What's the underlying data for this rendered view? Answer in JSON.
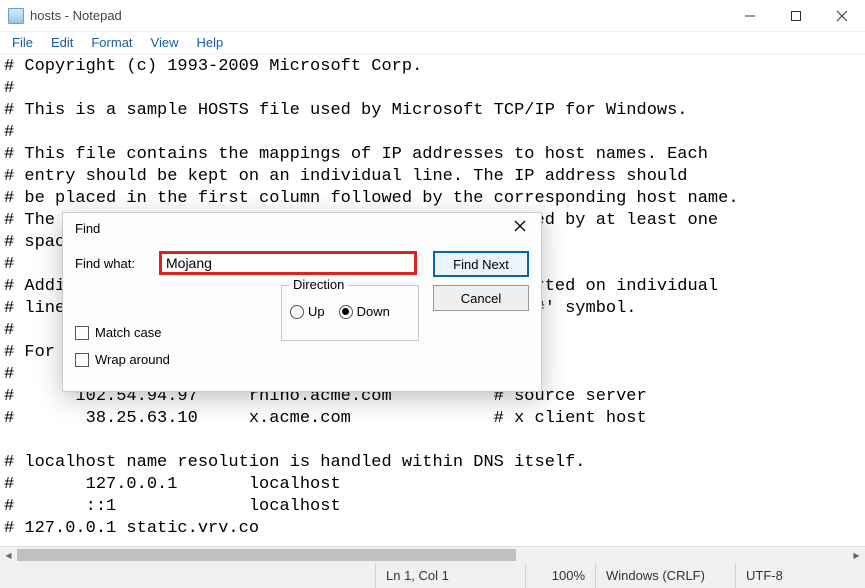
{
  "window": {
    "title": "hosts - Notepad"
  },
  "menu": {
    "file": "File",
    "edit": "Edit",
    "format": "Format",
    "view": "View",
    "help": "Help"
  },
  "editor": {
    "content": "# Copyright (c) 1993-2009 Microsoft Corp.\n#\n# This is a sample HOSTS file used by Microsoft TCP/IP for Windows.\n#\n# This file contains the mappings of IP addresses to host names. Each\n# entry should be kept on an individual line. The IP address should\n# be placed in the first column followed by the corresponding host name.\n# The IP address and the host name should be separated by at least one\n# space.\n#\n# Additionally, comments (such as these) may be inserted on individual\n# lines or following the machine name denoted by a '#' symbol.\n#\n# For example:\n#\n#      102.54.94.97     rhino.acme.com          # source server\n#       38.25.63.10     x.acme.com              # x client host\n\n# localhost name resolution is handled within DNS itself.\n#       127.0.0.1       localhost\n#       ::1             localhost\n# 127.0.0.1 static.vrv.co"
  },
  "find": {
    "title": "Find",
    "label": "Find what:",
    "value": "Mojang ",
    "findNext": "Find Next",
    "cancel": "Cancel",
    "direction": "Direction",
    "up": "Up",
    "down": "Down",
    "matchCase": "Match case",
    "wrapAround": "Wrap around"
  },
  "status": {
    "lncol": "Ln 1, Col 1",
    "zoom": "100%",
    "eol": "Windows (CRLF)",
    "encoding": "UTF-8"
  }
}
